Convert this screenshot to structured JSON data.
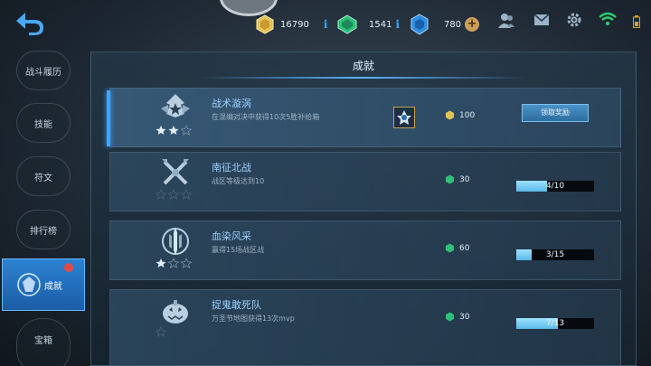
{
  "header": {
    "gold": "16790",
    "diamonds": "1541",
    "coupons": "780",
    "info_glyph": "i",
    "plus_glyph": "+"
  },
  "sidebar": {
    "items": [
      {
        "label": "战斗履历"
      },
      {
        "label": "技能"
      },
      {
        "label": "符文"
      },
      {
        "label": "排行榜"
      },
      {
        "label": "成就"
      },
      {
        "label": "宝箱"
      }
    ]
  },
  "panel": {
    "title": "成就",
    "achievements": [
      {
        "name": "战术漩涡",
        "desc": "在混编对决中获得10次5胜补给箱",
        "reward": "100",
        "reward_type": "gold",
        "stars": 2,
        "action": "领取奖励"
      },
      {
        "name": "南征北战",
        "desc": "战区等级达到10",
        "reward": "30",
        "reward_type": "diamond",
        "stars": 0,
        "progress": "4/10",
        "progress_value": 0.4
      },
      {
        "name": "血染风采",
        "desc": "赢得15场战区战",
        "reward": "60",
        "reward_type": "diamond",
        "stars": 1,
        "progress": "3/15",
        "progress_value": 0.2
      },
      {
        "name": "捉鬼敢死队",
        "desc": "万圣节地图获得13次mvp",
        "reward": "30",
        "reward_type": "diamond",
        "stars": 0,
        "progress": "7/13",
        "progress_value": 0.54
      }
    ]
  },
  "colors": {
    "accent": "#43a4ff",
    "claim_button": "#3c80b5",
    "progress_fill": "#7ccdf3",
    "notification_dot": "#e64a47"
  },
  "icons": [
    "back-arrow-icon",
    "gold-coin-icon",
    "green-diamond-icon",
    "blue-gem-icon",
    "friends-icon",
    "mail-icon",
    "settings-icon",
    "wifi-icon",
    "battery-icon",
    "achievement-emblem-icon",
    "star-icon"
  ]
}
